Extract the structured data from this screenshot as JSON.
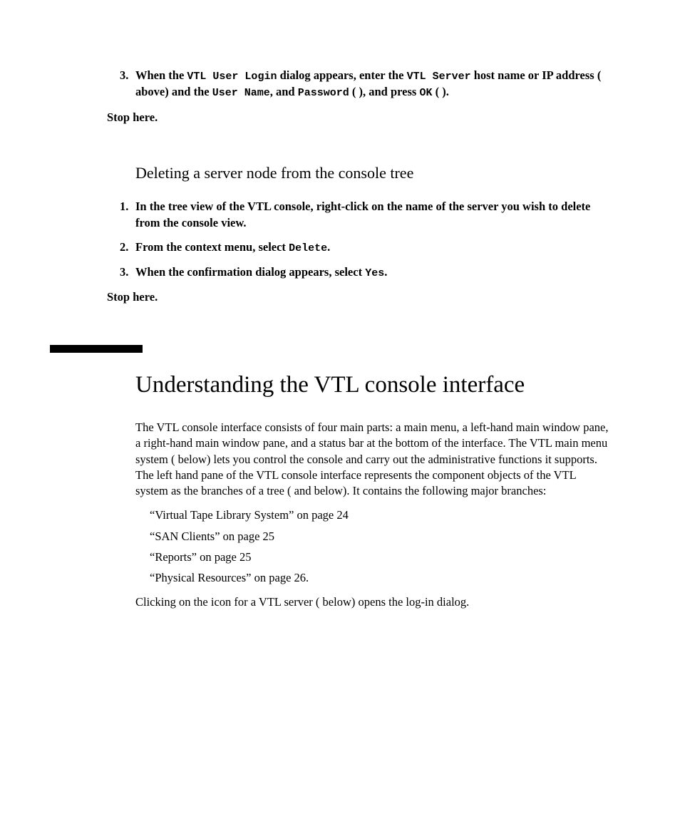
{
  "step3": {
    "num": "3.",
    "t1": "When the ",
    "m1": "VTL User Login",
    "t2": " dialog appears, enter the ",
    "m2": "VTL Server",
    "t3": " host name or IP address (   above) and the ",
    "m3": "User Name",
    "t4": ", and ",
    "m4": "Password",
    "t5": " (  ), and press ",
    "m5": "OK",
    "t6": " (  )."
  },
  "stop1": "Stop here.",
  "subheading": "Deleting a server node from the console tree",
  "d1": {
    "num": "1.",
    "text": "In the tree view of the VTL console, right-click on the name of the server you wish to delete from the console view."
  },
  "d2": {
    "num": "2.",
    "t1": "From the context menu, select ",
    "m1": "Delete",
    "t2": "."
  },
  "d3": {
    "num": "3.",
    "t1": "When the confirmation dialog appears, select ",
    "m1": "Yes",
    "t2": "."
  },
  "stop2": "Stop here.",
  "h1": "Understanding the VTL console interface",
  "para1": "The VTL console interface consists of four main parts: a main menu, a left-hand main window pane, a right-hand main window pane, and a status bar at the bottom of the interface. The VTL main menu system (   below) lets you control the console and carry out the administrative functions it supports. The left hand pane of the VTL console interface represents the component objects of the VTL system as the branches of a tree (   and    below). It contains the following major branches:",
  "refs": {
    "r1": "“Virtual Tape Library System” on page 24",
    "r2": "“SAN Clients” on page 25",
    "r3": "“Reports” on page 25",
    "r4": "“Physical Resources” on page 26."
  },
  "para2": "Clicking on the icon for a VTL server (   below) opens the log-in dialog."
}
